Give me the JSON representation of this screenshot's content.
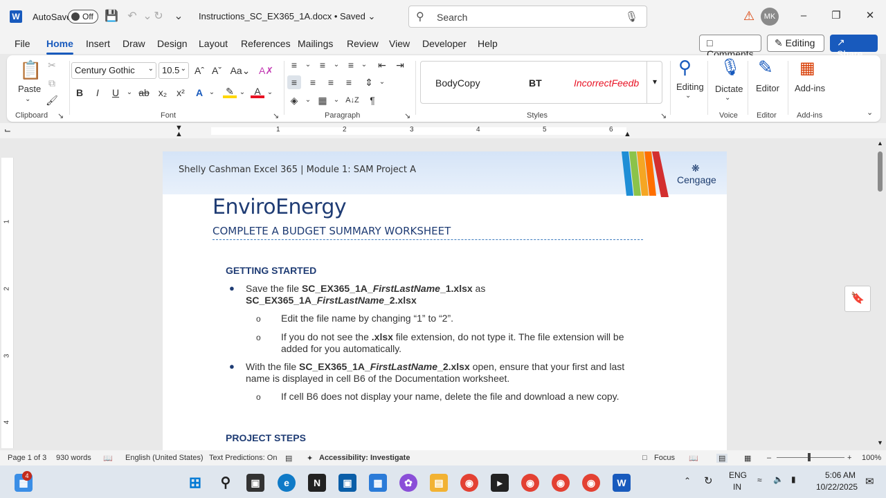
{
  "titlebar": {
    "autosave_label": "AutoSave",
    "toggle_state": "Off",
    "doc_title": "Instructions_SC_EX365_1A.docx • Saved",
    "search_placeholder": "Search",
    "avatar_initials": "MK"
  },
  "tabs": [
    "File",
    "Home",
    "Insert",
    "Draw",
    "Design",
    "Layout",
    "References",
    "Mailings",
    "Review",
    "View",
    "Developer",
    "Help"
  ],
  "active_tab": "Home",
  "header_buttons": {
    "comments": "Comments",
    "editing": "Editing",
    "share": "Share"
  },
  "ribbon": {
    "clipboard": {
      "paste": "Paste",
      "label": "Clipboard"
    },
    "font": {
      "name": "Century Gothic",
      "size": "10.5",
      "label": "Font"
    },
    "paragraph": {
      "label": "Paragraph"
    },
    "styles": {
      "items": [
        "BodyCopy",
        "BT",
        "IncorrectFeedb"
      ],
      "label": "Styles"
    },
    "editing": {
      "label": "Editing"
    },
    "voice": {
      "dictate": "Dictate",
      "label": "Voice"
    },
    "editor": {
      "editor": "Editor",
      "label": "Editor"
    },
    "addins": {
      "addins": "Add-ins",
      "label": "Add-ins"
    }
  },
  "ruler": {
    "numbers": [
      "1",
      "2",
      "3",
      "4",
      "5",
      "6"
    ],
    "vertical_numbers": [
      "1",
      "2",
      "3",
      "4"
    ]
  },
  "document": {
    "header_text": "Shelly Cashman Excel 365 | Module 1: SAM Project A",
    "brand": "Cengage",
    "title": "EnviroEnergy",
    "subtitle": "COMPLETE A BUDGET SUMMARY WORKSHEET",
    "section1": "GETTING STARTED",
    "bullet1_pre": "Save the file ",
    "bullet1_file1": "SC_EX365_1A_",
    "bullet1_file1_italic": "FirstLastName",
    "bullet1_file1_end": "_1.xlsx",
    "bullet1_as": " as",
    "bullet1_file2": "SC_EX365_1A_",
    "bullet1_file2_italic": "FirstLastName",
    "bullet1_file2_end": "_2.xlsx",
    "sub1": "Edit the file name by changing “1” to “2”.",
    "sub2_pre": "If you do not see the ",
    "sub2_bold": ".xlsx",
    "sub2_post": " file extension, do not type it. The file extension will be",
    "sub2_line2": "added for you automatically.",
    "bullet2_pre": "With the file ",
    "bullet2_file": "SC_EX365_1A_",
    "bullet2_file_italic": "FirstLastName",
    "bullet2_file_end": "_2.xlsx",
    "bullet2_post": " open, ensure that your first and last",
    "bullet2_line2": "name is displayed in cell B6 of the Documentation worksheet.",
    "sub3": "If cell B6 does not display your name, delete the file and download a new copy.",
    "section2": "PROJECT STEPS"
  },
  "statusbar": {
    "page": "Page 1 of 3",
    "words": "930 words",
    "language": "English (United States)",
    "predictions": "Text Predictions: On",
    "accessibility": "Accessibility: Investigate",
    "focus": "Focus",
    "zoom": "100%"
  },
  "taskbar": {
    "badge": "4",
    "lang": "ENG",
    "lang2": "IN",
    "time": "5:06 AM",
    "date": "10/22/2025"
  }
}
